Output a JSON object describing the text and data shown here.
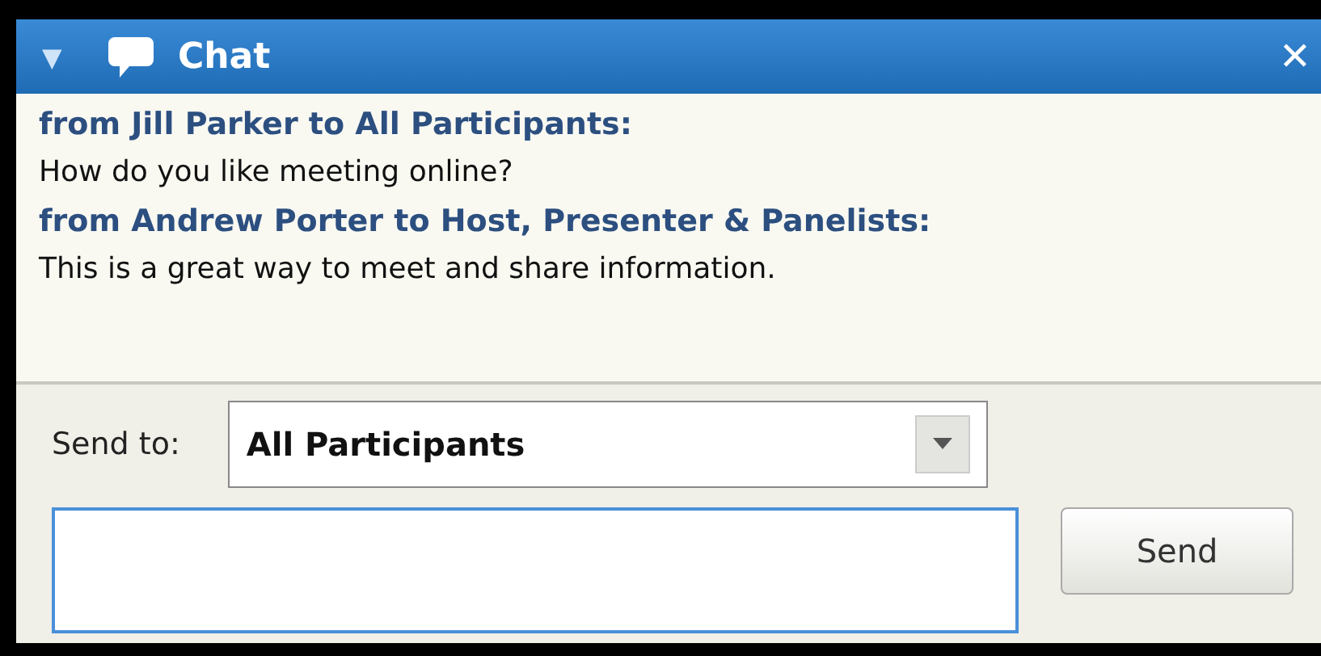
{
  "window": {
    "title": "Chat",
    "collapse_icon": "▼",
    "close_icon": "✕"
  },
  "messages": [
    {
      "header": "from Jill Parker to All Participants:",
      "text": "How do you like meeting online?"
    },
    {
      "header": "from Andrew Porter to Host, Presenter & Panelists:",
      "text": "This is a great way to meet and share information."
    }
  ],
  "send_to": {
    "label": "Send to:",
    "value": "All Participants"
  },
  "buttons": [
    "Send"
  ]
}
